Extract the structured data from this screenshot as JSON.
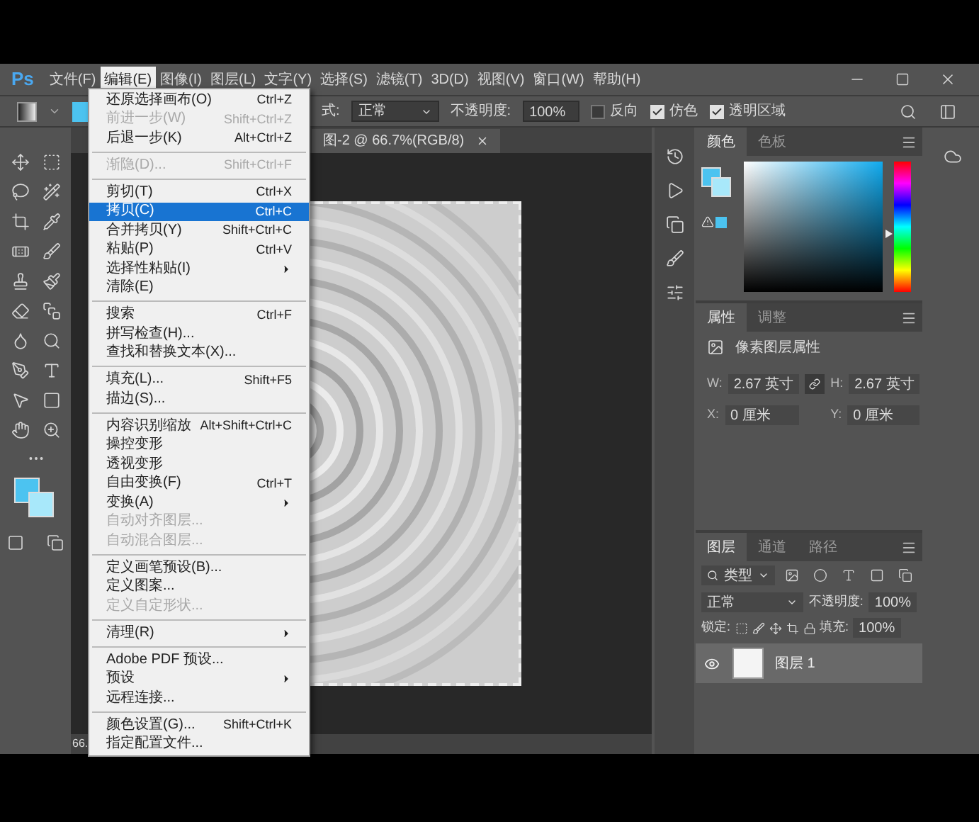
{
  "app": {
    "logo": "Ps"
  },
  "menubar": [
    {
      "label": "文件(F)",
      "selected": false
    },
    {
      "label": "编辑(E)",
      "selected": true
    },
    {
      "label": "图像(I)",
      "selected": false
    },
    {
      "label": "图层(L)",
      "selected": false
    },
    {
      "label": "文字(Y)",
      "selected": false
    },
    {
      "label": "选择(S)",
      "selected": false
    },
    {
      "label": "滤镜(T)",
      "selected": false
    },
    {
      "label": "3D(D)",
      "selected": false
    },
    {
      "label": "视图(V)",
      "selected": false
    },
    {
      "label": "窗口(W)",
      "selected": false
    },
    {
      "label": "帮助(H)",
      "selected": false
    }
  ],
  "options_bar": {
    "mode_label": "式:",
    "mode": "正常",
    "opacity_label": "不透明度:",
    "opacity": "100%",
    "checks": [
      {
        "label": "反向",
        "checked": false
      },
      {
        "label": "仿色",
        "checked": true
      },
      {
        "label": "透明区域",
        "checked": true
      }
    ]
  },
  "document": {
    "tab": "图-2 @ 66.7%(RGB/8)",
    "status_zoom": "66."
  },
  "edit_menu": [
    {
      "kind": "item",
      "label": "还原选择画布(O)",
      "shortcut": "Ctrl+Z",
      "disabled": false,
      "selected": false,
      "submenu": false
    },
    {
      "kind": "item",
      "label": "前进一步(W)",
      "shortcut": "Shift+Ctrl+Z",
      "disabled": true,
      "selected": false,
      "submenu": false
    },
    {
      "kind": "item",
      "label": "后退一步(K)",
      "shortcut": "Alt+Ctrl+Z",
      "disabled": false,
      "selected": false,
      "submenu": false
    },
    {
      "kind": "separator"
    },
    {
      "kind": "item",
      "label": "渐隐(D)...",
      "shortcut": "Shift+Ctrl+F",
      "disabled": true,
      "selected": false,
      "submenu": false
    },
    {
      "kind": "separator"
    },
    {
      "kind": "item",
      "label": "剪切(T)",
      "shortcut": "Ctrl+X",
      "disabled": false,
      "selected": false,
      "submenu": false
    },
    {
      "kind": "item",
      "label": "拷贝(C)",
      "shortcut": "Ctrl+C",
      "disabled": false,
      "selected": true,
      "submenu": false
    },
    {
      "kind": "item",
      "label": "合并拷贝(Y)",
      "shortcut": "Shift+Ctrl+C",
      "disabled": false,
      "selected": false,
      "submenu": false
    },
    {
      "kind": "item",
      "label": "粘贴(P)",
      "shortcut": "Ctrl+V",
      "disabled": false,
      "selected": false,
      "submenu": false
    },
    {
      "kind": "item",
      "label": "选择性粘贴(I)",
      "disabled": false,
      "selected": false,
      "submenu": true
    },
    {
      "kind": "item",
      "label": "清除(E)",
      "disabled": false,
      "selected": false,
      "submenu": false
    },
    {
      "kind": "separator"
    },
    {
      "kind": "item",
      "label": "搜索",
      "shortcut": "Ctrl+F",
      "disabled": false,
      "selected": false,
      "submenu": false
    },
    {
      "kind": "item",
      "label": "拼写检查(H)...",
      "disabled": false,
      "selected": false,
      "submenu": false
    },
    {
      "kind": "item",
      "label": "查找和替换文本(X)...",
      "disabled": false,
      "selected": false,
      "submenu": false
    },
    {
      "kind": "separator"
    },
    {
      "kind": "item",
      "label": "填充(L)...",
      "shortcut": "Shift+F5",
      "disabled": false,
      "selected": false,
      "submenu": false
    },
    {
      "kind": "item",
      "label": "描边(S)...",
      "disabled": false,
      "selected": false,
      "submenu": false
    },
    {
      "kind": "separator"
    },
    {
      "kind": "item",
      "label": "内容识别缩放",
      "shortcut": "Alt+Shift+Ctrl+C",
      "disabled": false,
      "selected": false,
      "submenu": false
    },
    {
      "kind": "item",
      "label": "操控变形",
      "disabled": false,
      "selected": false,
      "submenu": false
    },
    {
      "kind": "item",
      "label": "透视变形",
      "disabled": false,
      "selected": false,
      "submenu": false
    },
    {
      "kind": "item",
      "label": "自由变换(F)",
      "shortcut": "Ctrl+T",
      "disabled": false,
      "selected": false,
      "submenu": false
    },
    {
      "kind": "item",
      "label": "变换(A)",
      "disabled": false,
      "selected": false,
      "submenu": true
    },
    {
      "kind": "item",
      "label": "自动对齐图层...",
      "disabled": true,
      "selected": false,
      "submenu": false
    },
    {
      "kind": "item",
      "label": "自动混合图层...",
      "disabled": true,
      "selected": false,
      "submenu": false
    },
    {
      "kind": "separator"
    },
    {
      "kind": "item",
      "label": "定义画笔预设(B)...",
      "disabled": false,
      "selected": false,
      "submenu": false
    },
    {
      "kind": "item",
      "label": "定义图案...",
      "disabled": false,
      "selected": false,
      "submenu": false
    },
    {
      "kind": "item",
      "label": "定义自定形状...",
      "disabled": true,
      "selected": false,
      "submenu": false
    },
    {
      "kind": "separator"
    },
    {
      "kind": "item",
      "label": "清理(R)",
      "disabled": false,
      "selected": false,
      "submenu": true
    },
    {
      "kind": "separator"
    },
    {
      "kind": "item",
      "label": "Adobe PDF 预设...",
      "disabled": false,
      "selected": false,
      "submenu": false
    },
    {
      "kind": "item",
      "label": "预设",
      "disabled": false,
      "selected": false,
      "submenu": true
    },
    {
      "kind": "item",
      "label": "远程连接...",
      "disabled": false,
      "selected": false,
      "submenu": false
    },
    {
      "kind": "separator"
    },
    {
      "kind": "item",
      "label": "颜色设置(G)...",
      "shortcut": "Shift+Ctrl+K",
      "disabled": false,
      "selected": false,
      "submenu": false
    },
    {
      "kind": "item",
      "label": "指定配置文件...",
      "disabled": false,
      "selected": false,
      "submenu": false
    }
  ],
  "color_panel": {
    "hue_slider": {
      "level": 0.45
    },
    "tabs": [
      {
        "label": "颜色",
        "selected": true
      },
      {
        "label": "色板",
        "selected": false
      }
    ]
  },
  "properties_panel": {
    "tabs": [
      {
        "label": "属性",
        "selected": true
      },
      {
        "label": "调整",
        "selected": false
      }
    ],
    "title": "像素图层属性",
    "fields": [
      {
        "label": "W:",
        "value": "2.67 英寸"
      },
      {
        "label": "H:",
        "value": "2.67 英寸"
      },
      {
        "label": "X:",
        "value": "0 厘米"
      },
      {
        "label": "Y:",
        "value": "0 厘米"
      }
    ]
  },
  "layers_panel": {
    "tabs": [
      {
        "label": "图层",
        "selected": true
      },
      {
        "label": "通道",
        "selected": false
      },
      {
        "label": "路径",
        "selected": false
      }
    ],
    "filter": "类型",
    "blend_mode": "正常",
    "opacity_label": "不透明度:",
    "opacity": "100%",
    "lock_label": "锁定:",
    "fill_label": "填充:",
    "fill": "100%",
    "layers": [
      {
        "name": "图层 1",
        "visible": true,
        "selected": true
      }
    ]
  }
}
